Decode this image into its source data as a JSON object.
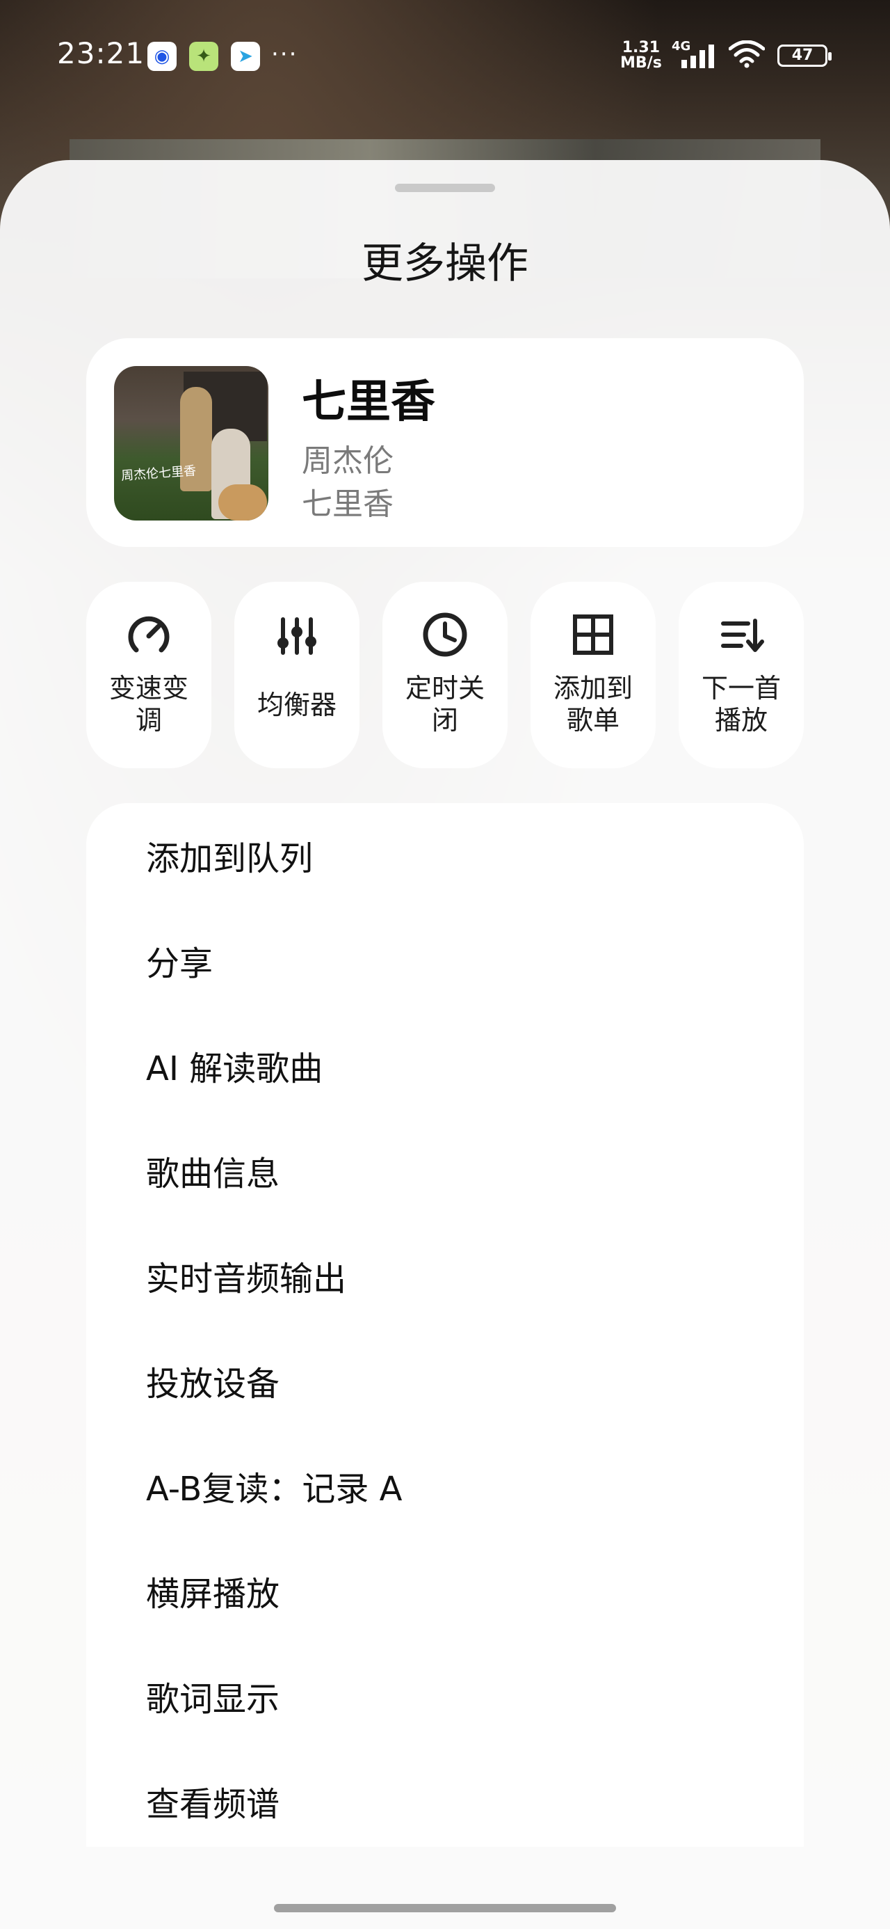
{
  "status_bar": {
    "time": "23:21",
    "net_speed_value": "1.31",
    "net_speed_unit": "MB/s",
    "network_type": "4G",
    "battery": "47",
    "more": "···"
  },
  "sheet": {
    "title": "更多操作"
  },
  "song": {
    "title": "七里香",
    "artist": "周杰伦",
    "album": "七里香",
    "album_art_text": "周杰伦七里香"
  },
  "quick_actions": [
    {
      "label_line1": "变速变",
      "label_line2": "调",
      "icon": "speed-gauge-icon"
    },
    {
      "label_line1": "均衡器",
      "label_line2": "",
      "icon": "equalizer-icon"
    },
    {
      "label_line1": "定时关",
      "label_line2": "闭",
      "icon": "clock-icon"
    },
    {
      "label_line1": "添加到",
      "label_line2": "歌单",
      "icon": "grid-add-icon"
    },
    {
      "label_line1": "下一首",
      "label_line2": "播放",
      "icon": "play-next-icon"
    }
  ],
  "menu": [
    "添加到队列",
    "分享",
    "AI 解读歌曲",
    "歌曲信息",
    "实时音频输出",
    "投放设备",
    "A-B复读：记录 A",
    "横屏播放",
    "歌词显示",
    "查看频谱"
  ]
}
